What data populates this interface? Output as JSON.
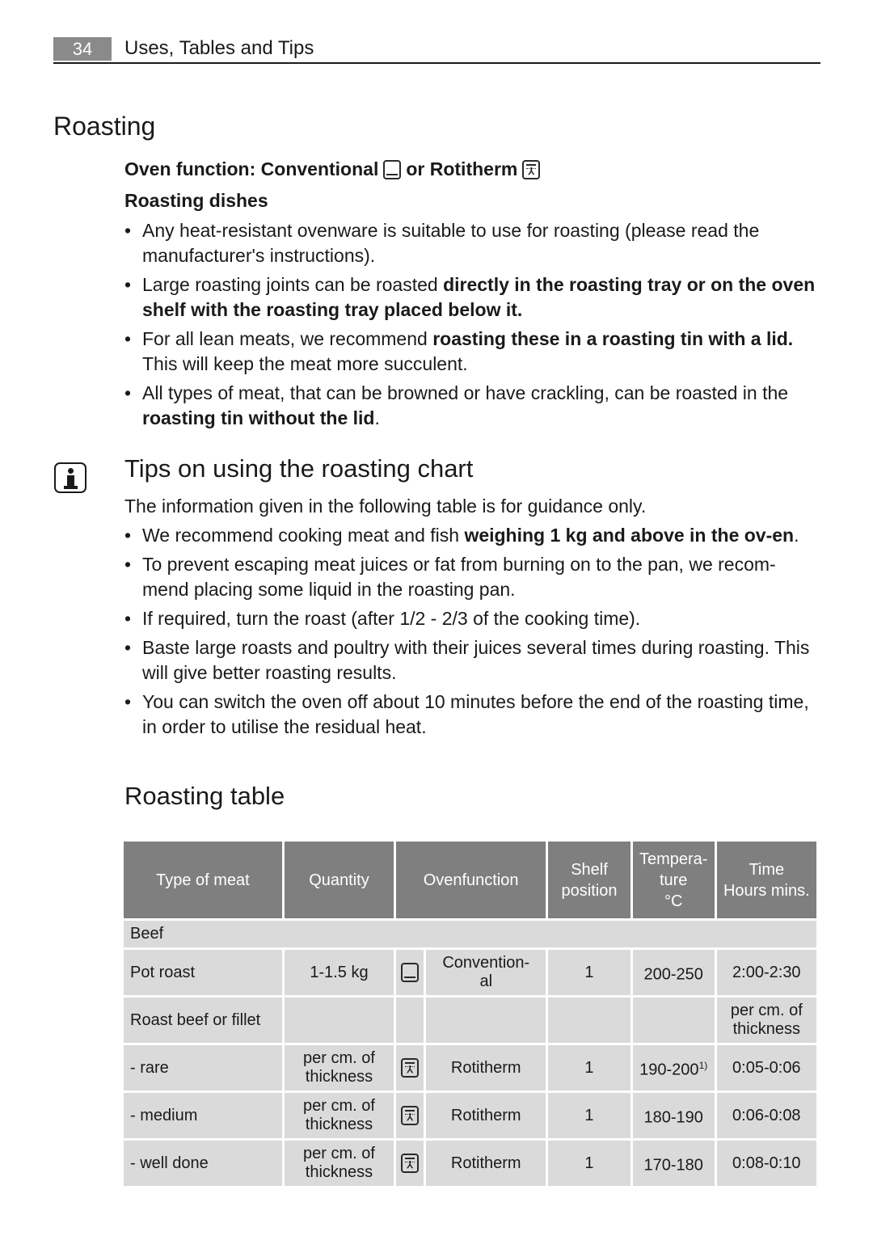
{
  "header": {
    "page_number": "34",
    "section_title": "Uses, Tables and Tips"
  },
  "roasting": {
    "title": "Roasting",
    "oven_function_prefix": "Oven function: Conventional",
    "oven_function_or": "or Rotitherm",
    "dishes_heading": "Roasting dishes",
    "bullets": [
      {
        "plain_before": "Any heat-resistant ovenware is suitable to use for roasting (please read the manufacturer's instructions).",
        "bold": "",
        "plain_after": ""
      },
      {
        "plain_before": "Large roasting joints can be roasted ",
        "bold": "directly in the roasting tray or on the oven shelf with the roasting tray placed below it.",
        "plain_after": ""
      },
      {
        "plain_before": "For all lean meats, we recommend ",
        "bold": "roasting these in a roasting tin with a lid.",
        "plain_after": " This will keep the meat more succulent."
      },
      {
        "plain_before": "All types of meat, that can be browned or have crackling, can be roasted in the ",
        "bold": "roasting tin without the lid",
        "plain_after": "."
      }
    ]
  },
  "tips": {
    "title": "Tips on using the roasting chart",
    "intro": "The information given in the following table is for guidance only.",
    "bullets": [
      {
        "plain_before": "We recommend cooking meat and fish ",
        "bold": "weighing 1 kg and above in the ov-en",
        "plain_after": "."
      },
      {
        "plain_before": "To prevent escaping meat juices or fat from burning on to the pan, we recom-mend placing some liquid in the roasting pan.",
        "bold": "",
        "plain_after": ""
      },
      {
        "plain_before": "If required, turn the roast (after 1/2 - 2/3 of the cooking time).",
        "bold": "",
        "plain_after": ""
      },
      {
        "plain_before": "Baste large roasts and poultry with their juices several times during roasting. This will give better roasting results.",
        "bold": "",
        "plain_after": ""
      },
      {
        "plain_before": "You can switch the oven off about 10 minutes before the end of the roasting time, in order to utilise the residual heat.",
        "bold": "",
        "plain_after": ""
      }
    ]
  },
  "table": {
    "title": "Roasting table",
    "headers": {
      "type": "Type of meat",
      "quantity": "Quantity",
      "ovenfunction": "Ovenfunction",
      "shelf": "Shelf position",
      "temp_line1": "Tempera-",
      "temp_line2": "ture",
      "temp_line3": "°C",
      "time_line1": "Time",
      "time_line2": "Hours mins."
    },
    "category": "Beef",
    "rows": [
      {
        "type": "Pot roast",
        "quantity": "1-1.5 kg",
        "icon": "conventional-icon",
        "function": "Convention-al",
        "shelf": "1",
        "temp": "200-250",
        "temp_note": "",
        "time": "2:00-2:30"
      },
      {
        "type": "Roast beef or fillet",
        "quantity": "",
        "icon": "",
        "function": "",
        "shelf": "",
        "temp": "",
        "temp_note": "",
        "time": "per cm. of thickness"
      },
      {
        "type": "- rare",
        "quantity": "per cm. of thickness",
        "icon": "rotitherm-icon",
        "function": "Rotitherm",
        "shelf": "1",
        "temp": "190-200",
        "temp_note": "1)",
        "time": "0:05-0:06"
      },
      {
        "type": "- medium",
        "quantity": "per cm. of thickness",
        "icon": "rotitherm-icon",
        "function": "Rotitherm",
        "shelf": "1",
        "temp": "180-190",
        "temp_note": "",
        "time": "0:06-0:08"
      },
      {
        "type": "- well done",
        "quantity": "per cm. of thickness",
        "icon": "rotitherm-icon",
        "function": "Rotitherm",
        "shelf": "1",
        "temp": "170-180",
        "temp_note": "",
        "time": "0:08-0:10"
      }
    ]
  },
  "colors": {
    "header_bg": "#7f7f7f",
    "cell_bg": "#dadada",
    "page_number_bg": "#8a8a8a"
  }
}
